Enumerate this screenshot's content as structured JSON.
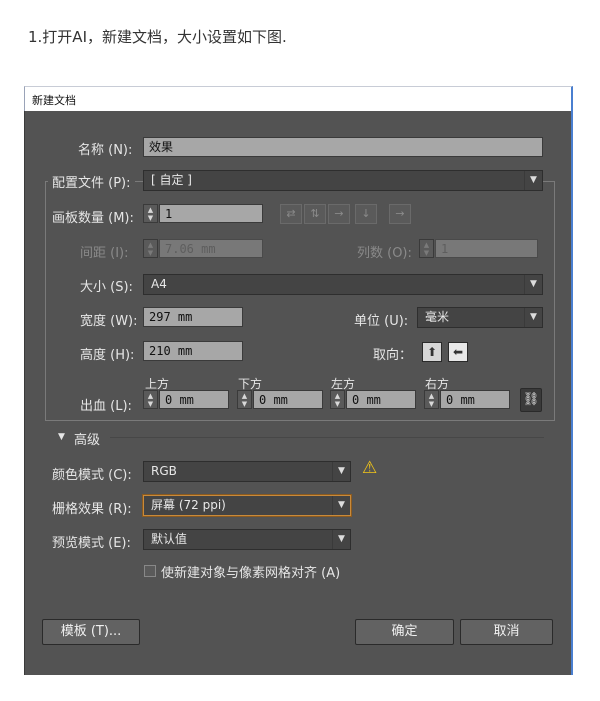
{
  "caption": "1.打开AI，新建文档，大小设置如下图.",
  "window": {
    "title": "新建文档"
  },
  "name": {
    "label": "名称 (N):",
    "value": "效果"
  },
  "profile": {
    "label": "配置文件 (P):",
    "value": "[ 自定 ]"
  },
  "artboards": {
    "label": "画板数量 (M):",
    "value": "1",
    "layout_icons": [
      "grid-by-row-icon",
      "grid-by-column-icon",
      "arrange-by-row-icon",
      "arrange-by-column-icon",
      "right-to-left-icon"
    ]
  },
  "spacing": {
    "label": "间距 (I):",
    "value": "7.06 mm"
  },
  "columns": {
    "label": "列数 (O):",
    "value": "1"
  },
  "size": {
    "label": "大小 (S):",
    "value": "A4"
  },
  "width": {
    "label": "宽度 (W):",
    "value": "297 mm"
  },
  "units": {
    "label": "单位 (U):",
    "value": "毫米"
  },
  "height": {
    "label": "高度 (H):",
    "value": "210 mm"
  },
  "orientation": {
    "label": "取向：",
    "options": [
      "portrait",
      "landscape"
    ],
    "selected": "landscape"
  },
  "bleed": {
    "label": "出血 (L):",
    "top": {
      "label": "上方",
      "value": "0 mm"
    },
    "bottom": {
      "label": "下方",
      "value": "0 mm"
    },
    "left": {
      "label": "左方",
      "value": "0 mm"
    },
    "right": {
      "label": "右方",
      "value": "0 mm"
    }
  },
  "advanced": {
    "label": "高级",
    "color_mode": {
      "label": "颜色模式 (C):",
      "value": "RGB",
      "warning": true
    },
    "raster": {
      "label": "栅格效果 (R):",
      "value": "屏幕 (72 ppi)"
    },
    "preview": {
      "label": "预览模式 (E):",
      "value": "默认值"
    },
    "align_pixel": {
      "label": "使新建对象与像素网格对齐 (A)",
      "checked": false
    }
  },
  "buttons": {
    "templates": "模板 (T)...",
    "ok": "确定",
    "cancel": "取消"
  },
  "colors": {
    "panel": "#535353",
    "field": "#a7a7a7",
    "accent_focus": "#c98a3a",
    "warning": "#f0c419"
  }
}
